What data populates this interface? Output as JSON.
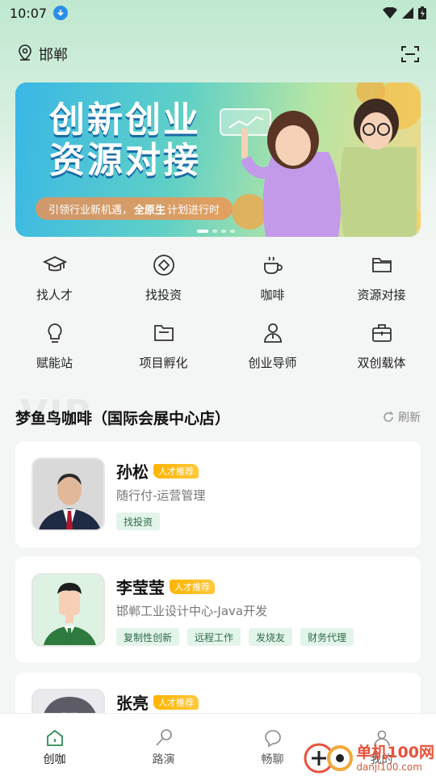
{
  "status_bar": {
    "time": "10:07"
  },
  "location": {
    "city": "邯郸"
  },
  "banner": {
    "title_line1": "创新创业",
    "title_line2": "资源对接",
    "subtitle_pre": "引领行业新机遇，",
    "subtitle_bold": "全原生",
    "subtitle_post": "计划进行时"
  },
  "menu": {
    "items": [
      {
        "label": "找人才",
        "icon": "graduation-cap-icon"
      },
      {
        "label": "找投资",
        "icon": "coin-icon"
      },
      {
        "label": "咖啡",
        "icon": "coffee-cup-icon"
      },
      {
        "label": "资源对接",
        "icon": "folder-icon"
      },
      {
        "label": "赋能站",
        "icon": "lightbulb-icon"
      },
      {
        "label": "项目孵化",
        "icon": "open-folder-icon"
      },
      {
        "label": "创业导师",
        "icon": "mentor-icon"
      },
      {
        "label": "双创载体",
        "icon": "briefcase-icon"
      }
    ]
  },
  "section": {
    "title": "梦鱼鸟咖啡（国际会展中心店）",
    "watermark": "VIP",
    "refresh_label": "刷新"
  },
  "cards": [
    {
      "name": "孙松",
      "badge": "人才推荐",
      "role": "随行付-运营管理",
      "tags": [
        "找投资"
      ]
    },
    {
      "name": "李莹莹",
      "badge": "人才推荐",
      "role": "邯郸工业设计中心-Java开发",
      "tags": [
        "复制性创新",
        "远程工作",
        "发烧友",
        "财务代理"
      ]
    },
    {
      "name": "张亮",
      "badge": "人才推荐"
    }
  ],
  "bottom_nav": {
    "items": [
      {
        "label": "创咖",
        "active": true
      },
      {
        "label": "路演"
      },
      {
        "label": "畅聊"
      },
      {
        "label": "我的"
      }
    ]
  },
  "watermark": {
    "brand": "单机100网",
    "url": "danji100.com"
  },
  "colors": {
    "accent_green": "#2d8a55",
    "tag_bg": "#e3f4ea",
    "badge_yellow": "#ffb400"
  }
}
